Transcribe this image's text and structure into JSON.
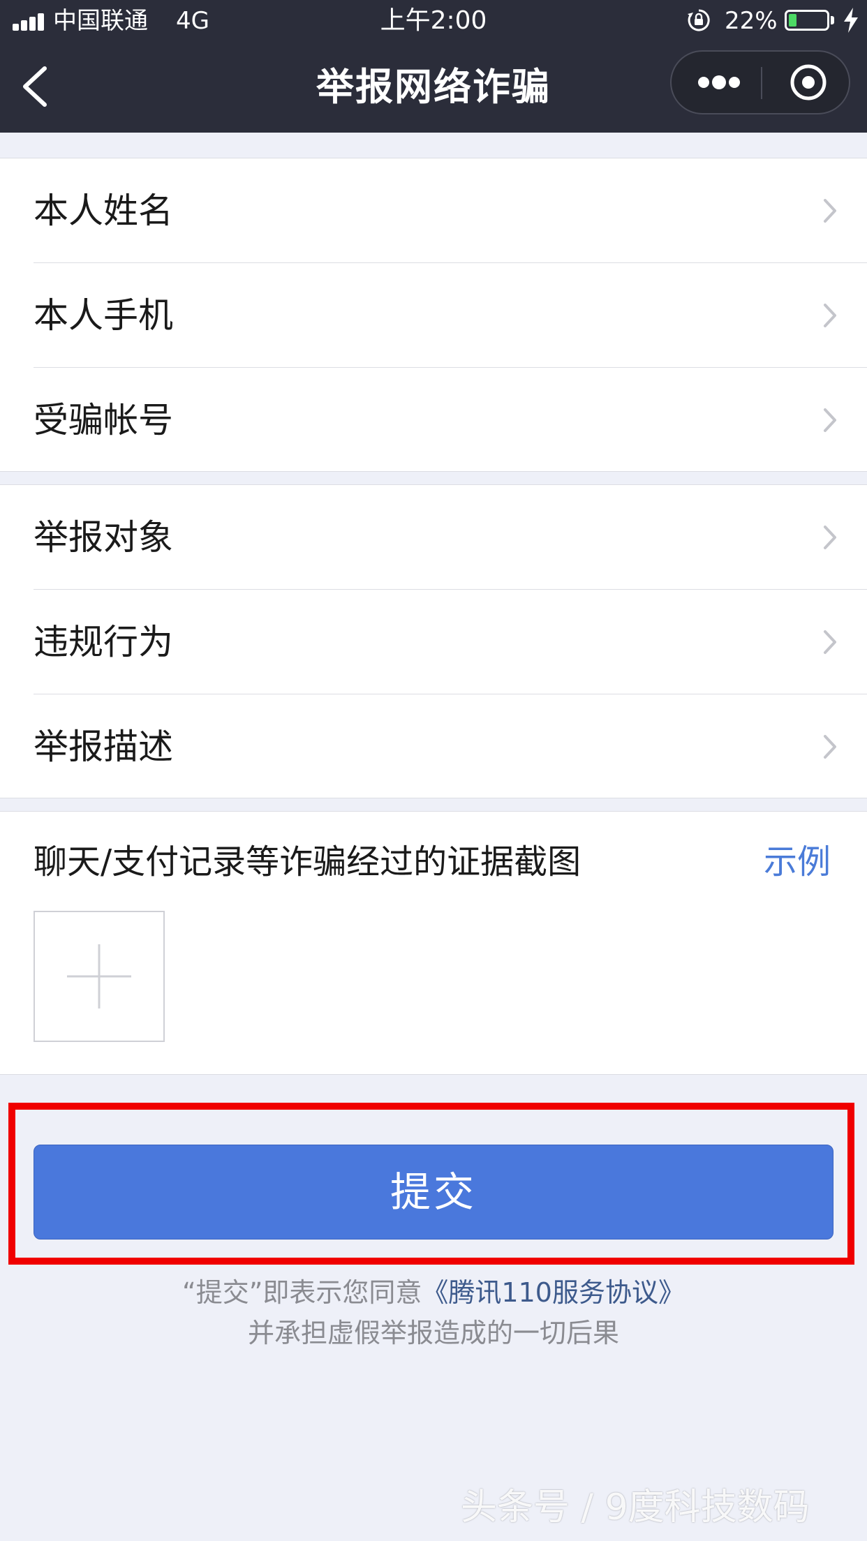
{
  "status_bar": {
    "carrier": "中国联通",
    "network": "4G",
    "time": "上午2:00",
    "battery_percent": "22%",
    "battery_level": 0.22
  },
  "nav": {
    "title": "举报网络诈骗",
    "back_icon": "chevron-left-icon",
    "more_icon": "more-dots-icon",
    "close_icon": "target-circle-icon"
  },
  "personal_group": [
    {
      "label": "本人姓名"
    },
    {
      "label": "本人手机"
    },
    {
      "label": "受骗帐号"
    }
  ],
  "report_group": [
    {
      "label": "举报对象"
    },
    {
      "label": "违规行为"
    },
    {
      "label": "举报描述"
    }
  ],
  "evidence": {
    "title": "聊天/支付记录等诈骗经过的证据截图",
    "example_label": "示例",
    "add_icon": "plus-icon"
  },
  "submit": {
    "label": "提交"
  },
  "agreement": {
    "prefix": "“提交”即表示您同意",
    "link": "《腾讯110服务协议》",
    "line2": "并承担虚假举报造成的一切后果"
  },
  "watermark": "头条号 / 9度科技数码",
  "colors": {
    "header_bg": "#2b2d3a",
    "page_bg": "#eef0f8",
    "primary_button": "#4a78dc",
    "link": "#4a7bd8",
    "highlight_border": "#f00000"
  }
}
